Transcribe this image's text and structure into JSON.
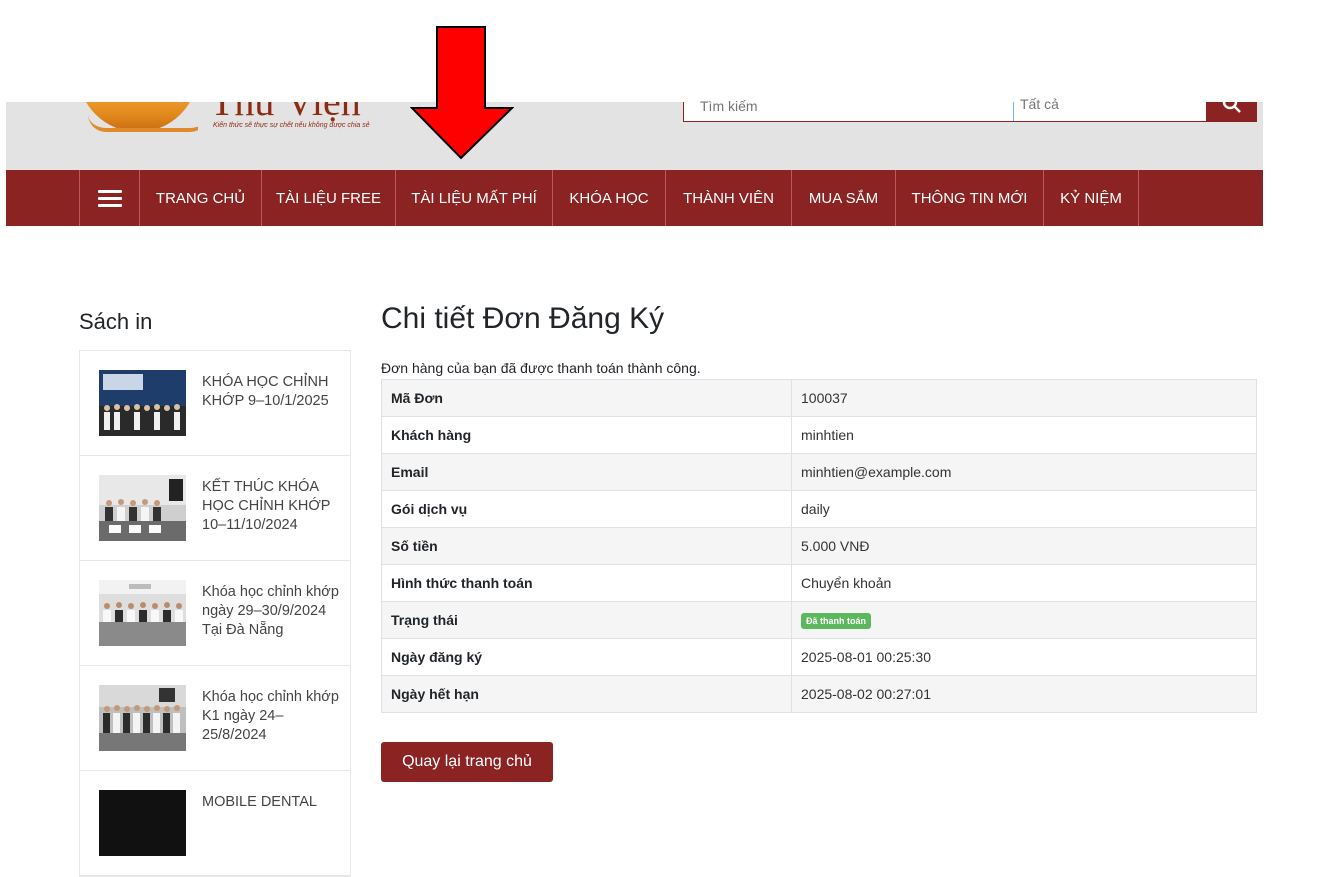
{
  "header": {
    "logo_title": "Thư Viện BIVA",
    "logo_tagline": "Kiến thức sẽ thực sự chết nếu không được chia sẻ",
    "search_placeholder": "Tìm kiếm",
    "search_category": "Tất cả"
  },
  "nav": {
    "items": [
      {
        "label": "TRANG CHỦ"
      },
      {
        "label": "TÀI LIỆU FREE"
      },
      {
        "label": "TÀI LIỆU MẤT PHÍ"
      },
      {
        "label": "KHÓA HỌC"
      },
      {
        "label": "THÀNH VIÊN"
      },
      {
        "label": "MUA SẮM"
      },
      {
        "label": "THÔNG TIN MỚI"
      },
      {
        "label": "KỶ NIỆM"
      }
    ]
  },
  "sidebar": {
    "title": "Sách in",
    "items": [
      {
        "label": "KHÓA HỌC CHỈNH KHỚP 9–10/1/2025"
      },
      {
        "label": "KẾT THÚC KHÓA HỌC CHỈNH KHỚP 10–11/10/2024"
      },
      {
        "label": "Khóa học chỉnh khớp ngày 29–30/9/2024 Tại Đà Nẵng"
      },
      {
        "label": "Khóa học chỉnh khớp K1 ngày 24–25/8/2024"
      },
      {
        "label": "MOBILE DENTAL"
      }
    ]
  },
  "main": {
    "title": "Chi tiết Đơn Đăng Ký",
    "success_message": "Đơn hàng của bạn đã được thanh toán thành công.",
    "rows": [
      {
        "key": "Mã Đơn",
        "value": "100037"
      },
      {
        "key": "Khách hàng",
        "value": "minhtien"
      },
      {
        "key": "Email",
        "value": "minhtien@example.com"
      },
      {
        "key": "Gói dịch vụ",
        "value": "daily"
      },
      {
        "key": "Số tiền",
        "value": "5.000 VNĐ"
      },
      {
        "key": "Hình thức thanh toán",
        "value": "Chuyển khoản"
      },
      {
        "key": "Trạng thái",
        "value": "Đã thanh toán"
      },
      {
        "key": "Ngày đăng ký",
        "value": "2025-08-01 00:25:30"
      },
      {
        "key": "Ngày hết hạn",
        "value": "2025-08-02 00:27:01"
      }
    ],
    "back_button": "Quay lại trang chủ"
  },
  "colors": {
    "brand": "#8b2323",
    "status_paid": "#5cb85c",
    "annotation_arrow": "#ff0000"
  }
}
